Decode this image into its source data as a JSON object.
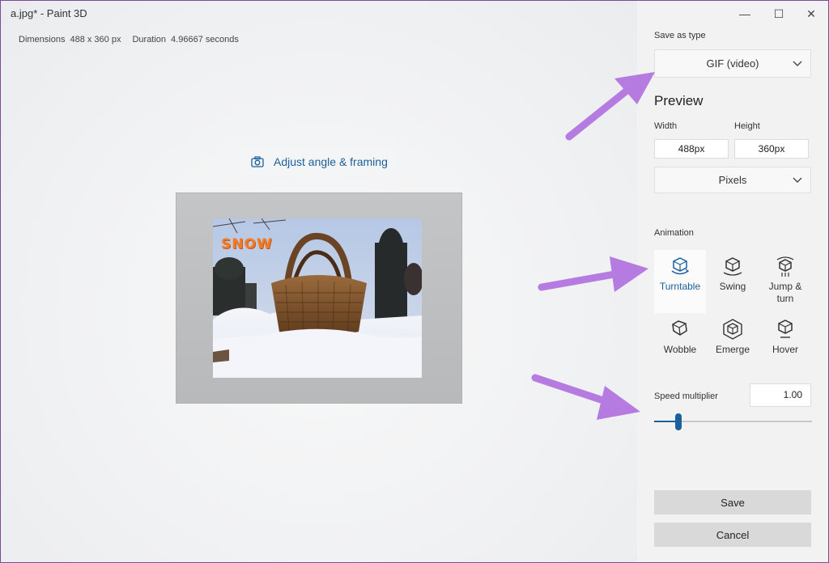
{
  "window": {
    "title": "a.jpg* - Paint 3D",
    "minimize_glyph": "—",
    "maximize_glyph": "☐",
    "close_glyph": "✕"
  },
  "meta": {
    "dimensions_label": "Dimensions",
    "dimensions_value": "488 x 360 px",
    "duration_label": "Duration",
    "duration_value": "4.96667 seconds"
  },
  "canvas": {
    "adjust_button_label": "Adjust angle & framing",
    "photo_text": "SNOW"
  },
  "panel": {
    "save_as_type_label": "Save as type",
    "save_as_type_value": "GIF (video)",
    "preview_heading": "Preview",
    "width_label": "Width",
    "height_label": "Height",
    "width_value": "488px",
    "height_value": "360px",
    "units_value": "Pixels",
    "animation_label": "Animation",
    "animations": [
      {
        "label": "Turntable",
        "icon": "turntable-icon",
        "selected": true
      },
      {
        "label": "Swing",
        "icon": "swing-icon",
        "selected": false
      },
      {
        "label": "Jump &\nturn",
        "icon": "jump-turn-icon",
        "selected": false
      },
      {
        "label": "Wobble",
        "icon": "wobble-icon",
        "selected": false
      },
      {
        "label": "Emerge",
        "icon": "emerge-icon",
        "selected": false
      },
      {
        "label": "Hover",
        "icon": "hover-icon",
        "selected": false
      }
    ],
    "speed_label": "Speed multiplier",
    "speed_value": "1.00",
    "save_label": "Save",
    "cancel_label": "Cancel"
  },
  "colors": {
    "accent": "#1b5f9c",
    "annotation_arrow": "#b57be0",
    "snow_text": "#f37c22"
  }
}
